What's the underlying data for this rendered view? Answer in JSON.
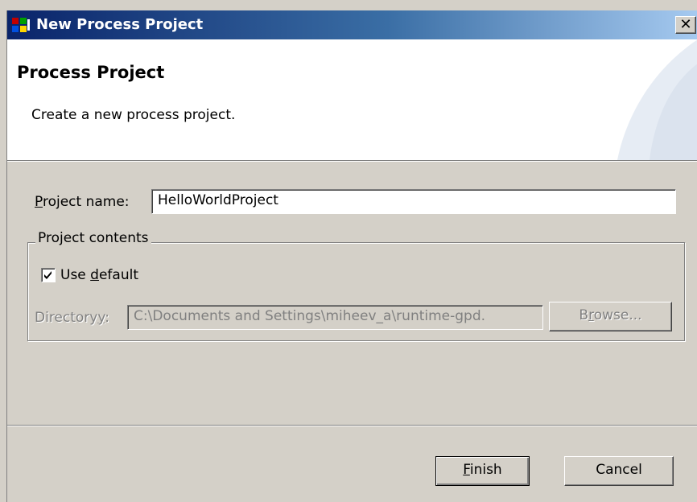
{
  "window": {
    "title": "New Process Project"
  },
  "banner": {
    "title": "Process Project",
    "description": "Create a new process project."
  },
  "project_name": {
    "label_mnemonic": "P",
    "label_rest": "roject name:",
    "value": "HelloWorldProject"
  },
  "contents": {
    "legend": "Project contents",
    "use_default": {
      "checked": true,
      "prefix": "Use ",
      "mnemonic": "d",
      "rest": "efault"
    },
    "directory": {
      "label_prefix": "Directory",
      "label_mnemonic": "y",
      "label_suffix": ":",
      "value": "C:\\Documents and Settings\\miheev_a\\runtime-gpd.",
      "enabled": false
    },
    "browse": {
      "prefix": "B",
      "mnemonic": "r",
      "rest": "owse...",
      "enabled": false
    }
  },
  "buttons": {
    "finish": {
      "mnemonic": "F",
      "rest": "inish"
    },
    "cancel": {
      "label": "Cancel"
    }
  },
  "icons": {
    "close": "close-icon",
    "app": "app-icon",
    "check": "checkmark-icon"
  }
}
